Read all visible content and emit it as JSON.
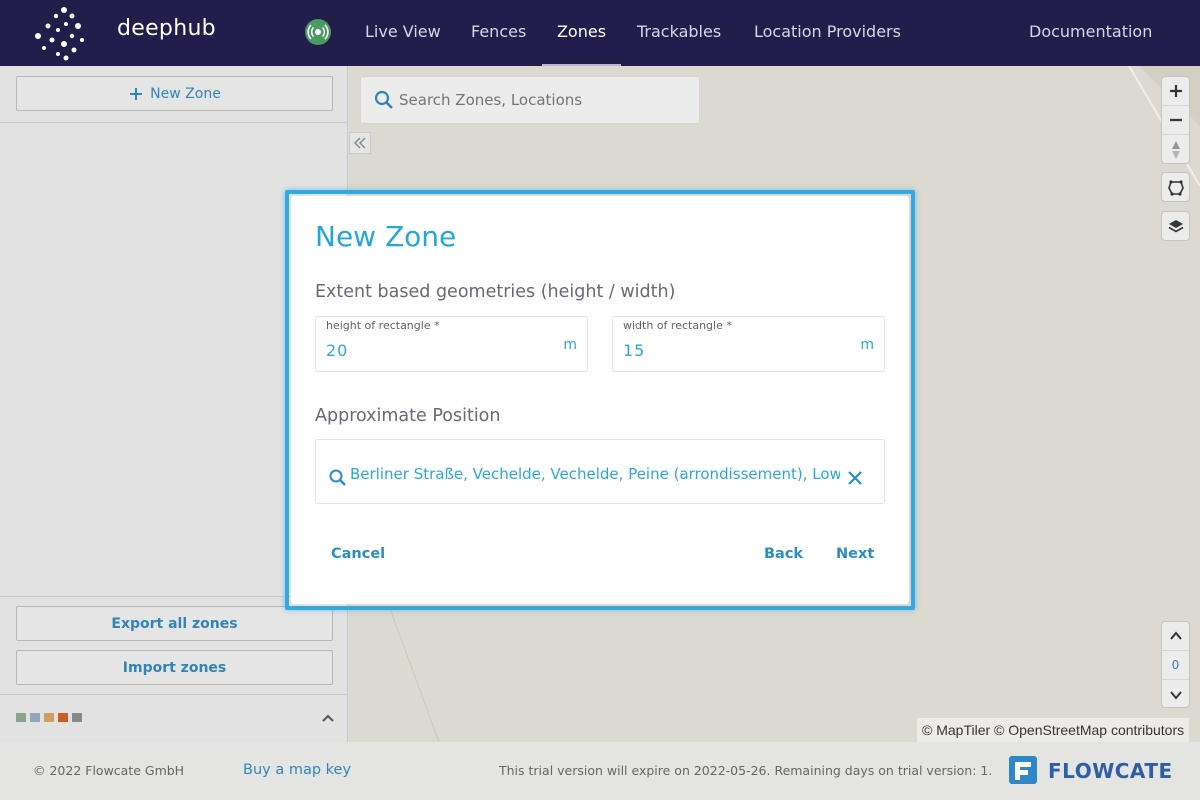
{
  "app": {
    "brand": "deephub",
    "status_indicator": "connected-broadcast-icon"
  },
  "nav": {
    "items": [
      {
        "label": "Live View",
        "active": false
      },
      {
        "label": "Fences",
        "active": false
      },
      {
        "label": "Zones",
        "active": true
      },
      {
        "label": "Trackables",
        "active": false
      },
      {
        "label": "Location Providers",
        "active": false
      }
    ],
    "documentation": "Documentation"
  },
  "sidebar": {
    "new_zone_label": "New Zone",
    "export_label": "Export all zones",
    "import_label": "Import zones",
    "swatches": [
      "#8fa892",
      "#9aa6c4",
      "#d6a35f",
      "#d35c23",
      "#8c8c8c"
    ]
  },
  "map": {
    "search_placeholder": "Search Zones, Locations",
    "level_number": "0",
    "attribution": "© MapTiler © OpenStreetMap contributors"
  },
  "dialog": {
    "title": "New Zone",
    "extent_section": "Extent based geometries (height / width)",
    "height_label": "height of rectangle *",
    "height_value": "20",
    "height_unit": "m",
    "width_label": "width of rectangle *",
    "width_value": "15",
    "width_unit": "m",
    "position_section": "Approximate Position",
    "position_value": "Berliner Straße, Vechelde, Vechelde, Peine (arrondissement), Lower",
    "cancel_label": "Cancel",
    "back_label": "Back",
    "next_label": "Next"
  },
  "footer": {
    "copyright": "© 2022 Flowcate GmbH",
    "buy_key": "Buy a map key",
    "trial_notice": "This trial version will expire on 2022-05-26. Remaining days on trial version: 1.",
    "company": "FLOWCATE"
  },
  "colors": {
    "header_bg": "#221d4a",
    "accent": "#29a8db",
    "link": "#2f86bf",
    "dialog_border": "#33a9e0"
  }
}
